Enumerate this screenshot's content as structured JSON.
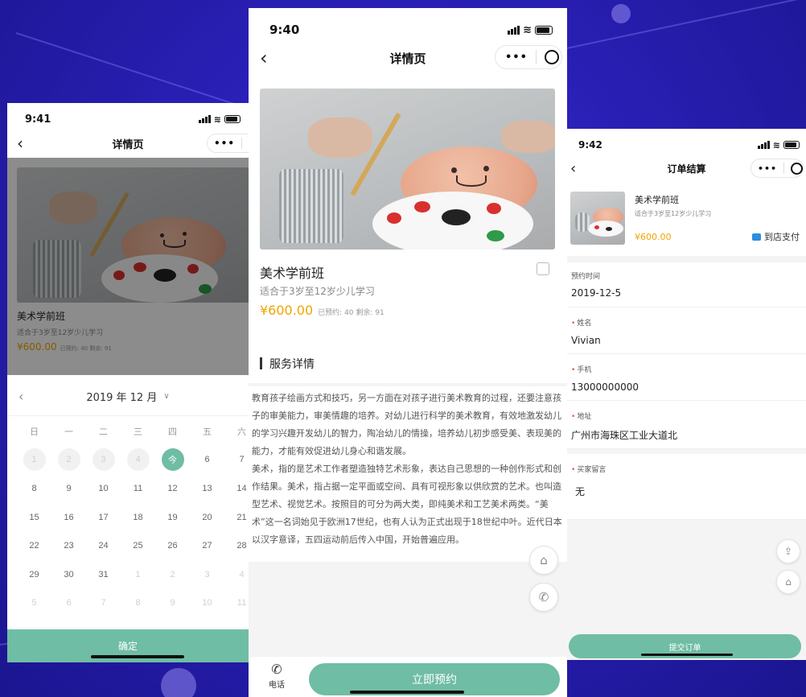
{
  "colors": {
    "accent": "#6fbda4",
    "price": "#f0a500",
    "background": "#2a1fb5"
  },
  "course": {
    "title": "美术学前班",
    "subtitle": "适合于3岁至12岁少儿学习",
    "price": "¥600.00",
    "booked_text": "已预约: 40  剩余: 91"
  },
  "screen_left": {
    "time": "9:41",
    "nav_title": "详情页",
    "calendar": {
      "month": "2019 年 12 月",
      "weekdays": [
        "日",
        "一",
        "二",
        "三",
        "四",
        "五",
        "六"
      ],
      "rows": [
        [
          "1",
          "2",
          "3",
          "4",
          "今",
          "6",
          "7"
        ],
        [
          "8",
          "9",
          "10",
          "11",
          "12",
          "13",
          "14"
        ],
        [
          "15",
          "16",
          "17",
          "18",
          "19",
          "20",
          "21"
        ],
        [
          "22",
          "23",
          "24",
          "25",
          "26",
          "27",
          "28"
        ],
        [
          "29",
          "30",
          "31",
          "1",
          "2",
          "3",
          "4"
        ],
        [
          "5",
          "6",
          "7",
          "8",
          "9",
          "10",
          "11"
        ]
      ]
    },
    "confirm_label": "确定"
  },
  "screen_center": {
    "time": "9:40",
    "nav_title": "详情页",
    "section_title": "服务详情",
    "description": [
      "教育孩子绘画方式和技巧，另一方面在对孩子进行美术教育的过程，还要注意孩子的审美能力，审美情趣的培养。对幼儿进行科学的美术教育，有效地激发幼儿的学习兴趣开发幼儿的智力，陶冶幼儿的情操，培养幼儿初步感受美、表现美的能力，才能有效促进幼儿身心和谐发展。",
      "美术，指的是艺术工作者塑造独特艺术形象，表达自己思想的一种创作形式和创作结果。美术，指占据一定平面或空间、具有可视形象以供欣赏的艺术。也叫造型艺术、视觉艺术。按照目的可分为两大类，即纯美术和工艺美术两类。“美术”这一名词始见于欧洲17世纪，也有人认为正式出现于18世纪中叶。近代日本以汉字意译，五四运动前后传入中国，开始普遍应用。"
    ],
    "phone_label": "电话",
    "book_label": "立即预约"
  },
  "screen_right": {
    "time": "9:42",
    "nav_title": "订单结算",
    "pay_label": "到店支付",
    "fields": [
      {
        "label": "预约时间",
        "required": false,
        "value": "2019-12-5"
      },
      {
        "label": "姓名",
        "required": true,
        "value": "Vivian"
      },
      {
        "label": "手机",
        "required": true,
        "value": "13000000000"
      },
      {
        "label": "地址",
        "required": true,
        "value": "广州市海珠区工业大道北"
      },
      {
        "label": "买家留言",
        "required": true,
        "value": "无"
      }
    ],
    "submit_label": "提交订单"
  }
}
